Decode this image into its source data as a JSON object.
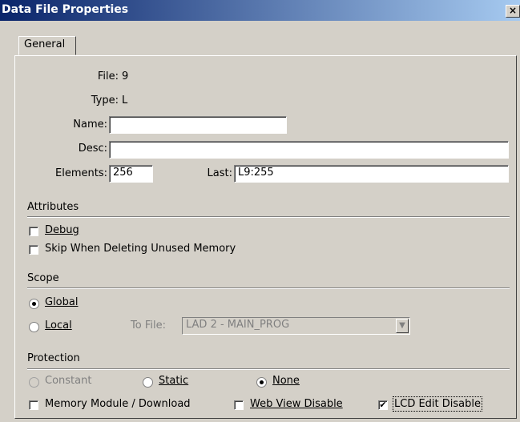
{
  "window": {
    "title": "Data File Properties",
    "close_glyph": "×"
  },
  "tabs": [
    {
      "label": "General"
    }
  ],
  "general": {
    "file_label": "File:",
    "file_value": "9",
    "type_label": "Type:",
    "type_value": "L",
    "name_label": "Name:",
    "name_value": "",
    "desc_label": "Desc:",
    "desc_value": "",
    "elements_label": "Elements:",
    "elements_value": "256",
    "last_label": "Last:",
    "last_value": "L9:255"
  },
  "attributes": {
    "heading": "Attributes",
    "debug_label": "Debug",
    "debug_checked": false,
    "skip_label": "Skip When Deleting Unused Memory",
    "skip_checked": false
  },
  "scope": {
    "heading": "Scope",
    "global_label": "Global",
    "global_selected": true,
    "local_label": "Local",
    "local_selected": false,
    "to_file_label": "To File:",
    "to_file_value": "LAD 2 - MAIN_PROG"
  },
  "protection": {
    "heading": "Protection",
    "constant_label": "Constant",
    "static_label": "Static",
    "none_label": "None",
    "selected": "None",
    "memory_module_label": "Memory Module / Download",
    "memory_module_checked": false,
    "web_view_label": "Web View Disable",
    "web_view_checked": false,
    "lcd_edit_label": "LCD Edit Disable",
    "lcd_edit_checked": true
  },
  "icons": {
    "checkmark": "✔",
    "combo_arrow": "▼"
  }
}
